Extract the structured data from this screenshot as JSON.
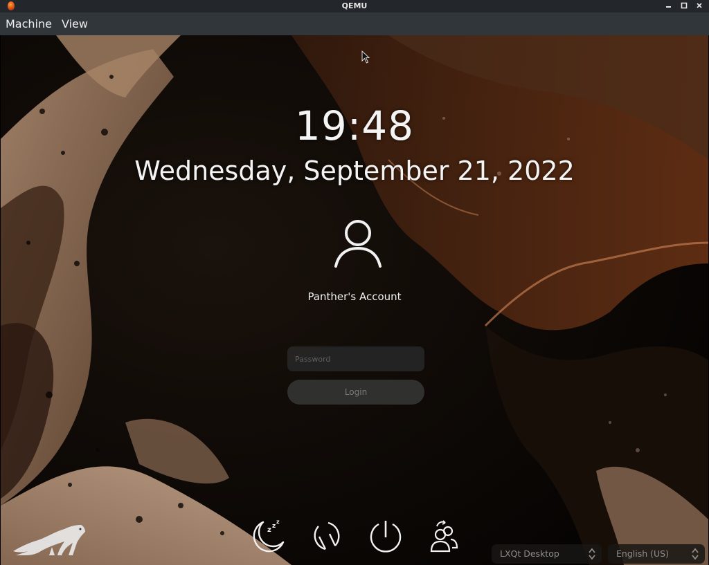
{
  "window": {
    "title": "QEMU",
    "icon": "qemu-icon",
    "controls": [
      "minimize-icon",
      "maximize-icon",
      "close-icon"
    ]
  },
  "menubar": {
    "items": [
      {
        "label": "Machine"
      },
      {
        "label": "View"
      }
    ]
  },
  "greeter": {
    "time": "19:48",
    "date": "Wednesday, September 21, 2022",
    "user": {
      "name": "Panther's Account",
      "avatar_icon": "user-icon"
    },
    "password": {
      "placeholder": "Password",
      "value": ""
    },
    "login_label": "Login",
    "actions": [
      {
        "name": "suspend",
        "icon": "sleep-icon"
      },
      {
        "name": "restart",
        "icon": "restart-icon"
      },
      {
        "name": "shutdown",
        "icon": "power-icon"
      },
      {
        "name": "switch-user",
        "icon": "switch-user-icon"
      }
    ],
    "session": {
      "selected": "LXQt Desktop"
    },
    "language": {
      "selected": "English (US)"
    },
    "logo": "panther-logo"
  },
  "colors": {
    "titlebar": "#23262a",
    "menubar": "#31363b",
    "text": "#f4f4f4",
    "accent_wallpaper": "#c8a488"
  }
}
